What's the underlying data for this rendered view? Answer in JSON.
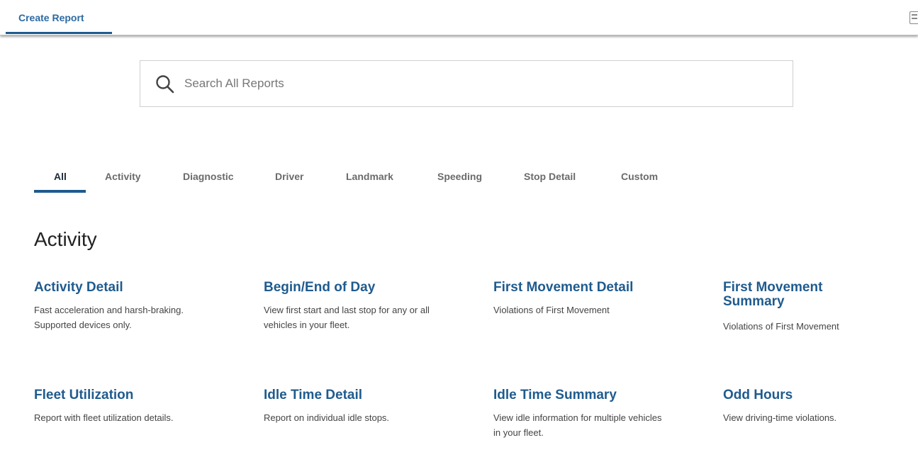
{
  "header": {
    "tab_label": "Create Report",
    "corner_icon": "calendar-icon"
  },
  "search": {
    "placeholder": "Search All Reports",
    "value": "",
    "icon": "search-icon"
  },
  "filters": {
    "active": "All",
    "tabs": [
      "All",
      "Activity",
      "Diagnostic",
      "Driver",
      "Landmark",
      "Speeding",
      "Stop Detail",
      "Custom"
    ]
  },
  "section": {
    "title": "Activity",
    "cards": [
      {
        "title": "Activity Detail",
        "desc": "Fast acceleration and harsh-braking. Supported devices only."
      },
      {
        "title": "Begin/End of Day",
        "desc": "View first start and last stop for any or all vehicles in your fleet."
      },
      {
        "title": "First Movement Detail",
        "desc": "Violations of First Movement"
      },
      {
        "title": "First Movement Summary",
        "desc": "Violations of First Movement"
      },
      {
        "title": "Fleet Utilization",
        "desc": "Report with fleet utilization details."
      },
      {
        "title": "Idle Time Detail",
        "desc": "Report on individual idle stops."
      },
      {
        "title": "Idle Time Summary",
        "desc": "View idle information for multiple vehicles in your fleet."
      },
      {
        "title": "Odd Hours",
        "desc": "View driving-time violations."
      }
    ]
  },
  "colors": {
    "accent": "#1e5a8e",
    "link": "#1f5b8e",
    "tab_inactive": "#6b6b6b"
  }
}
